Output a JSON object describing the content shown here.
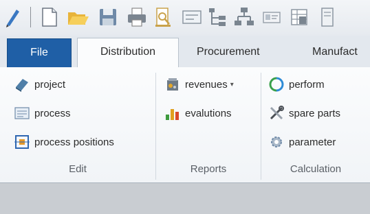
{
  "quick_access": {
    "icons": [
      "edit-icon",
      "new-document-icon",
      "open-folder-icon",
      "save-icon",
      "print-icon",
      "print-preview-icon",
      "form-icon",
      "tree-icon",
      "hierarchy-icon",
      "card-icon",
      "grid-icon",
      "document-icon"
    ]
  },
  "tabs": {
    "file": "File",
    "distribution": "Distribution",
    "procurement": "Procurement",
    "manufacturing": "Manufact"
  },
  "ribbon": {
    "edit": {
      "label": "Edit",
      "items": [
        "project",
        "process",
        "process positions"
      ]
    },
    "reports": {
      "label": "Reports",
      "items": [
        "revenues",
        "evalutions"
      ]
    },
    "calculation": {
      "label": "Calculation",
      "items": [
        "perform",
        "spare parts",
        "parameter"
      ]
    }
  },
  "colors": {
    "file_tab": "#1f5fa6",
    "ribbon_bg": "#fbfcfd",
    "workspace": "#c9cdd2"
  }
}
